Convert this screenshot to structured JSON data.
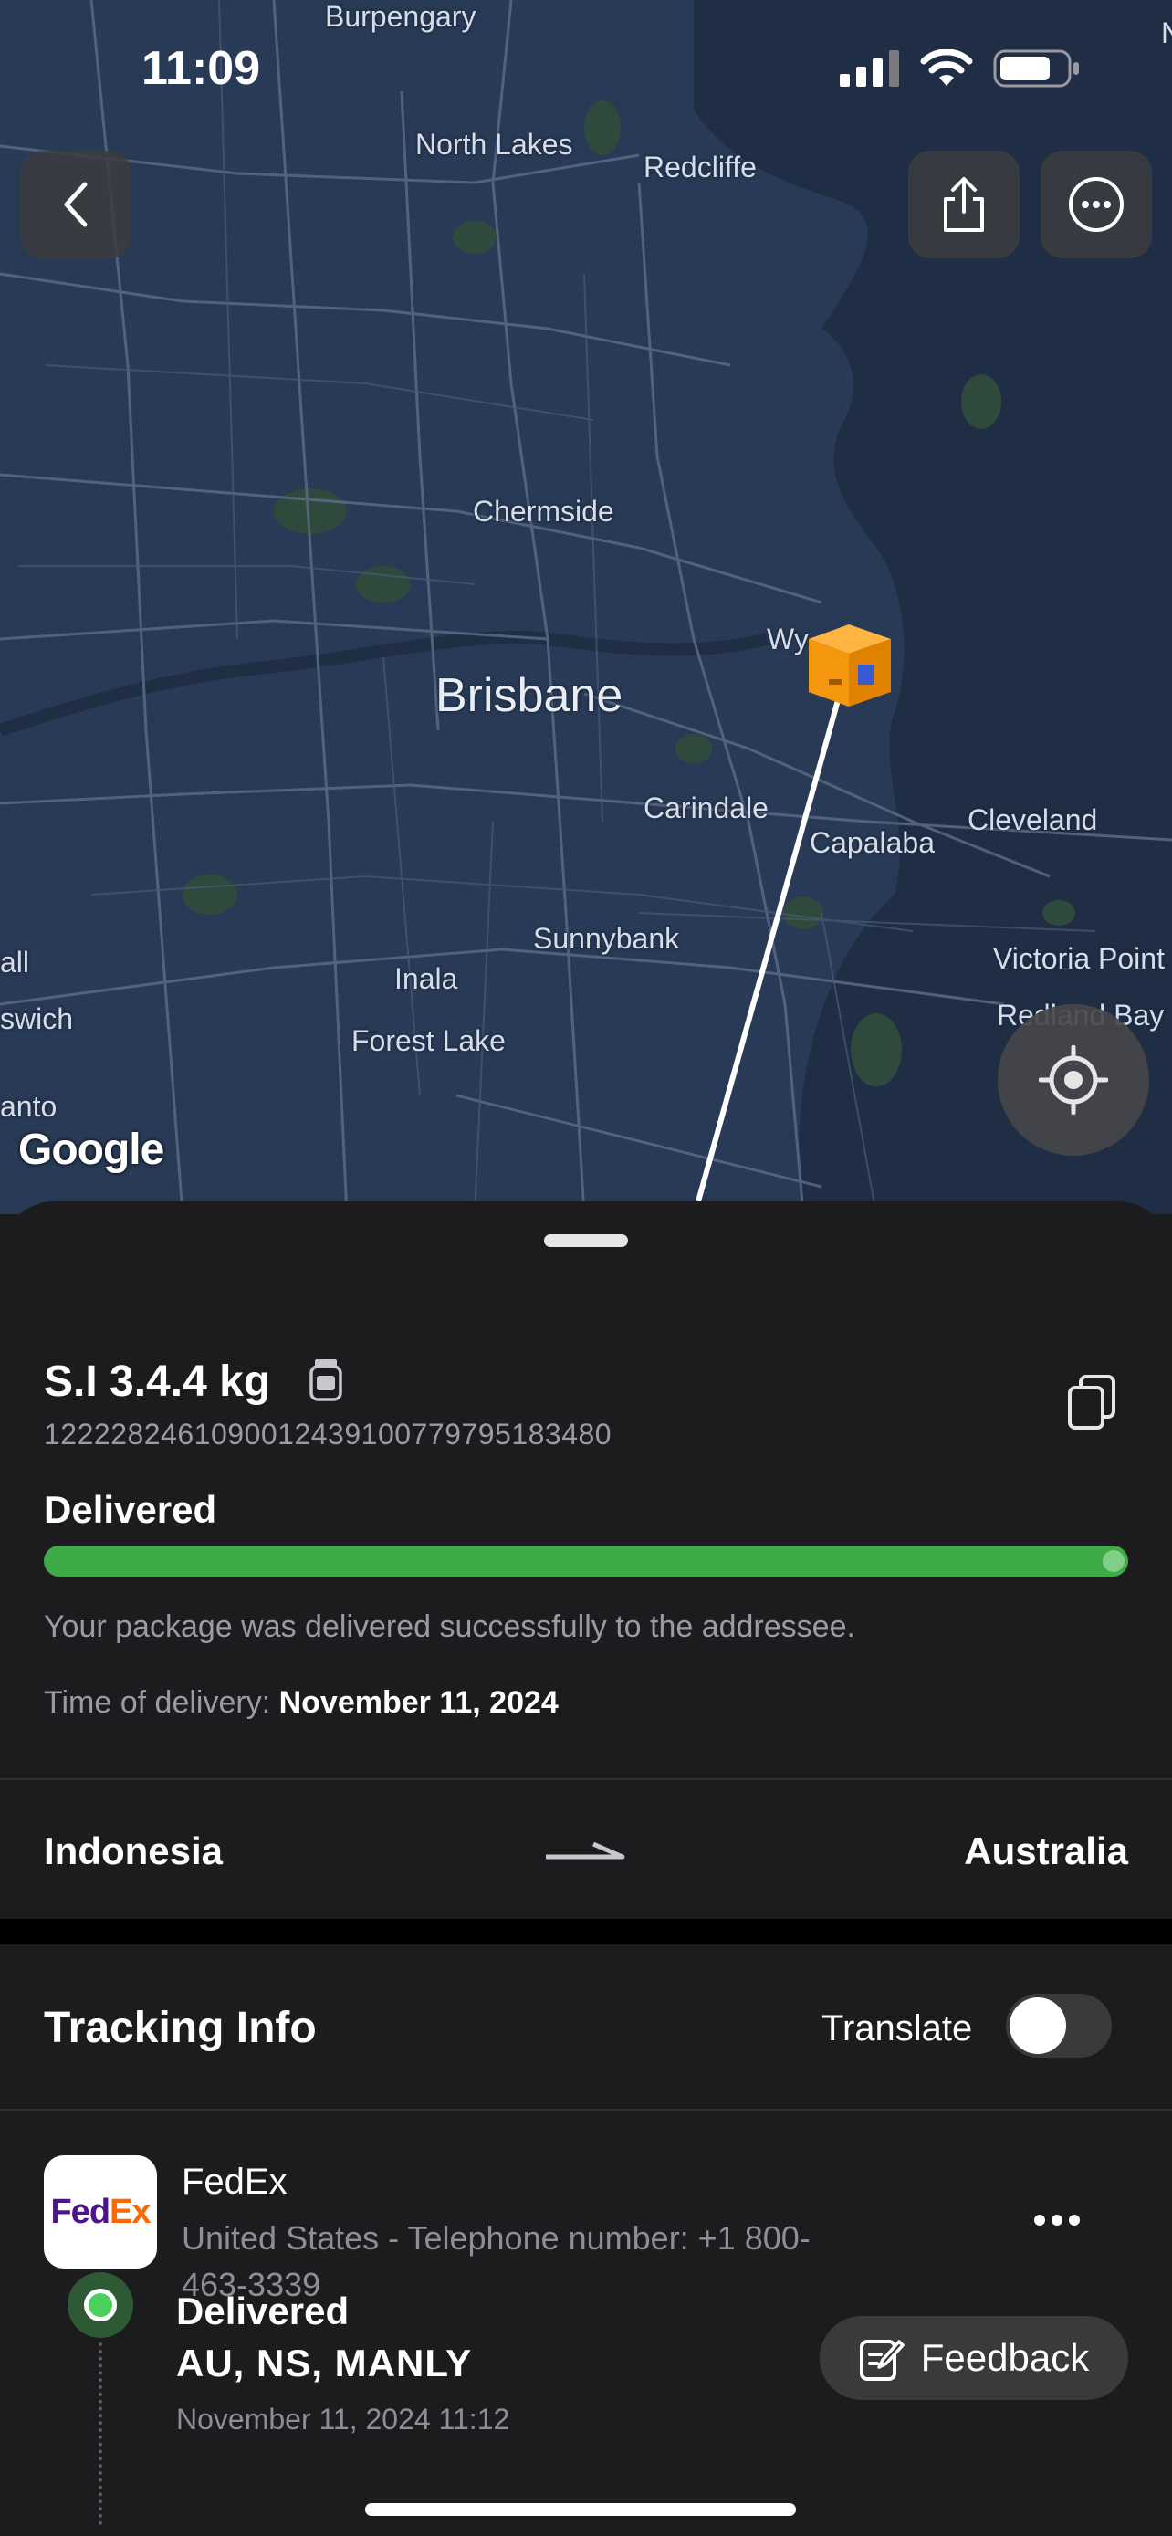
{
  "status_bar": {
    "time": "11:09"
  },
  "map": {
    "places": {
      "burpengary": "Burpengary",
      "north_lakes": "North Lakes",
      "redcliffe": "Redcliffe",
      "chermside": "Chermside",
      "brisbane": "Brisbane",
      "wynnum": "Wy",
      "carindale": "Carindale",
      "capalaba": "Capalaba",
      "cleveland": "Cleveland",
      "sunnybank": "Sunnybank",
      "inala": "Inala",
      "forest_lake": "Forest Lake",
      "victoria_point": "Victoria Point",
      "redland_bay": "Redland Bay",
      "left_1": "all",
      "left_2": "swich",
      "left_3": "anto",
      "edge_n": "N"
    },
    "attribution": "Google"
  },
  "package": {
    "title": "S.I 3.4.4 kg",
    "tracking_number": "1222282461090012439100779795183480",
    "status": "Delivered",
    "progress_percent": 100,
    "description": "Your package was delivered successfully to the addressee.",
    "delivery_time_label": "Time of delivery:",
    "delivery_time_value": "November 11, 2024"
  },
  "route": {
    "origin": "Indonesia",
    "destination": "Australia"
  },
  "tracking": {
    "title": "Tracking Info",
    "translate_label": "Translate",
    "translate_on": false
  },
  "carrier": {
    "logo_fed": "Fed",
    "logo_ex": "Ex",
    "name": "FedEx",
    "info": "United States - Telephone number: +1 800-463-3339"
  },
  "latest_event": {
    "status": "Delivered",
    "location": "AU, NS, MANLY",
    "time": "November 11, 2024 11:12"
  },
  "feedback_label": "Feedback",
  "colors": {
    "accent_green": "#3cab48",
    "package_orange": "#f5960f",
    "map_bg": "#283a55"
  }
}
